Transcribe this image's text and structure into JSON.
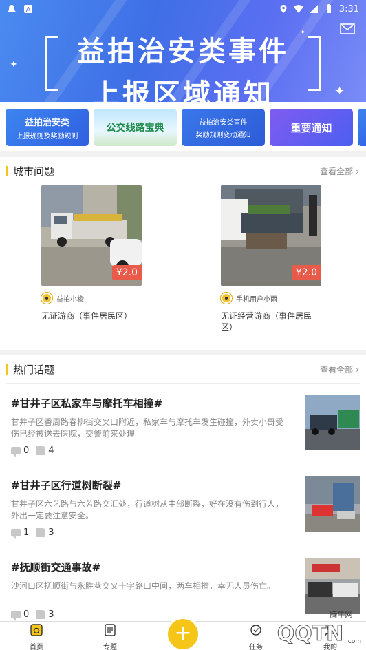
{
  "status_bar": {
    "time": "3:31"
  },
  "hero": {
    "line1": "益拍治安类事件",
    "line2": "上报区域通知"
  },
  "tiles": [
    {
      "line1": "益拍治安类",
      "line2": "上报规则及奖励规则"
    },
    {
      "line1": "公交线路宝典",
      "line2": ""
    },
    {
      "line1": "益拍治安类事件",
      "line2": "奖励规则变动通知"
    },
    {
      "line1": "重要通知",
      "line2": ""
    }
  ],
  "city": {
    "title": "城市问题",
    "more": "查看全部",
    "cards": [
      {
        "price": "¥2.0",
        "user": "益拍小楡",
        "desc": "无证游商（事件居民区）"
      },
      {
        "price": "¥2.0",
        "user": "手机用户小雨",
        "desc": "无证经营游商（事件居民区）"
      }
    ]
  },
  "hot": {
    "title": "热门话题",
    "more": "查看全部",
    "topics": [
      {
        "title": "#甘井子区私家车与摩托车相撞#",
        "desc": "甘井子区香周路春柳街交叉口附近，私家车与摩托车发生碰撞，外卖小哥受伤已经被送去医院，交警前来处理",
        "comments": "0",
        "likes": "4"
      },
      {
        "title": "#甘井子区行道树断裂#",
        "desc": "甘井子区六艺路与六芳路交汇处，行道树从中部断裂，好在没有伤到行人，外出一定要注意安全。",
        "comments": "1",
        "likes": "3"
      },
      {
        "title": "#抚顺街交通事故#",
        "desc": "沙河口区抚顺街与永胜巷交叉十字路口中间，两车相撞，幸无人员伤亡。",
        "comments": "0",
        "likes": "3"
      }
    ]
  },
  "nav": {
    "home": "首页",
    "topic": "专题",
    "task": "任务",
    "me": "我的"
  },
  "watermark": "QQTN.com"
}
